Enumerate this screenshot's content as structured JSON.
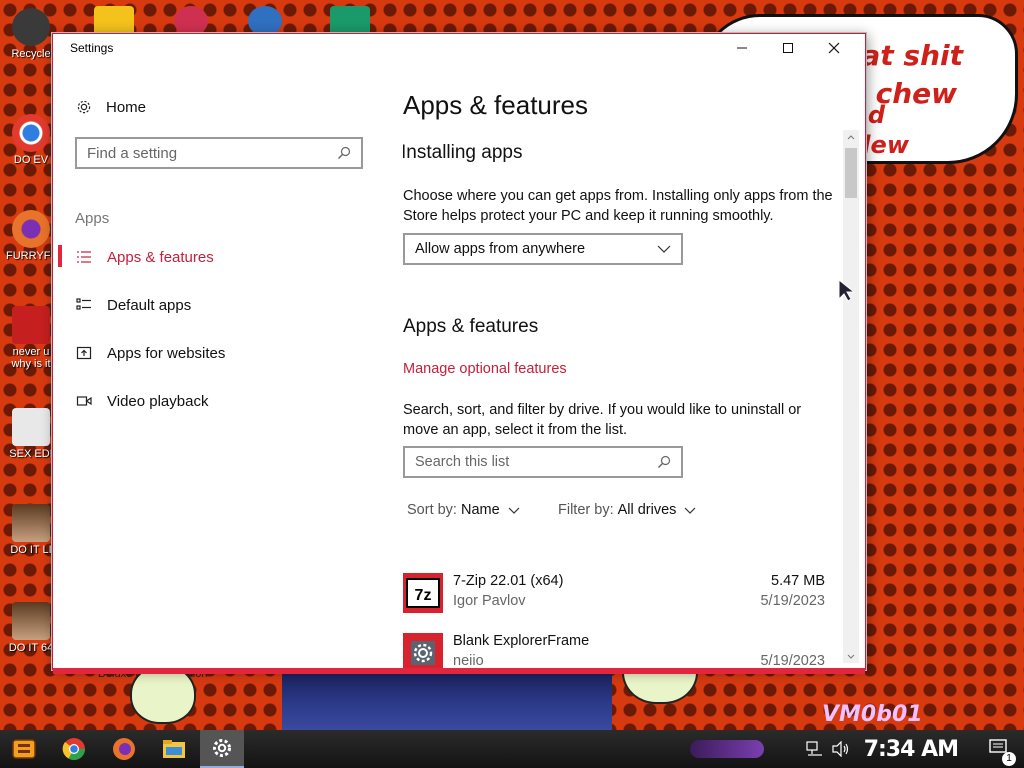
{
  "desktop": {
    "icons": [
      {
        "label": "Recycle",
        "icon": "recycle-bin-icon",
        "color": "#3a3a3a"
      },
      {
        "label": "DO EV",
        "icon": "chrome-icon",
        "color": "#2f7de1"
      },
      {
        "label": "FURRYFU",
        "icon": "firefox-icon",
        "color": "#e8732a"
      },
      {
        "label": "never u",
        "label2": "why is it",
        "icon": "dev-cpp-icon",
        "color": "#c51f1f"
      },
      {
        "label": "SEX EDI",
        "icon": "hex-editor-icon",
        "color": "#e0e0e0"
      },
      {
        "label": "DO IT LI",
        "icon": "portrait-icon",
        "color": "#7a5a40"
      },
      {
        "label": "DO IT 64",
        "icon": "portrait-icon",
        "color": "#7a5a40"
      }
    ],
    "bubble_lines": [
      "eat shit",
      "d chew",
      "d",
      "dew"
    ],
    "caption_small": "Deluxe Portrait Edition",
    "watermark": "VM0b01"
  },
  "window": {
    "title": "Settings",
    "controls": {
      "minimize": "minimize-icon",
      "maximize": "maximize-icon",
      "close": "close-icon"
    }
  },
  "sidebar": {
    "home_label": "Home",
    "search_placeholder": "Find a setting",
    "section_label": "Apps",
    "items": [
      {
        "label": "Apps & features",
        "icon": "list-icon",
        "active": true
      },
      {
        "label": "Default apps",
        "icon": "default-apps-icon",
        "active": false
      },
      {
        "label": "Apps for websites",
        "icon": "open-in-icon",
        "active": false
      },
      {
        "label": "Video playback",
        "icon": "video-icon",
        "active": false
      }
    ]
  },
  "main": {
    "page_title": "Apps & features",
    "installing": {
      "heading": "Installing apps",
      "description": "Choose where you can get apps from. Installing only apps from the Store helps protect your PC and keep it running smoothly.",
      "dropdown_value": "Allow apps from anywhere"
    },
    "apps_features": {
      "heading": "Apps & features",
      "link": "Manage optional features",
      "description": "Search, sort, and filter by drive. If you would like to uninstall or move an app, select it from the list.",
      "search_placeholder": "Search this list",
      "sort_label": "Sort by:",
      "sort_value": "Name",
      "filter_label": "Filter by:",
      "filter_value": "All drives"
    },
    "apps": [
      {
        "name": "7-Zip 22.01 (x64)",
        "publisher": "Igor Pavlov",
        "size": "5.47 MB",
        "date": "5/19/2023",
        "icon": "7zip-icon"
      },
      {
        "name": "Blank ExplorerFrame",
        "publisher": "neiio",
        "size": "",
        "date": "5/19/2023",
        "icon": "settings-gear-icon"
      }
    ]
  },
  "taskbar": {
    "clock": "7:34 AM",
    "notification_count": "1",
    "items": [
      "start-icon",
      "chrome-icon",
      "firefox-icon",
      "file-explorer-icon",
      "settings-icon"
    ]
  },
  "colors": {
    "accent": "#c4203a",
    "desktop_bg": "#d83a10"
  }
}
